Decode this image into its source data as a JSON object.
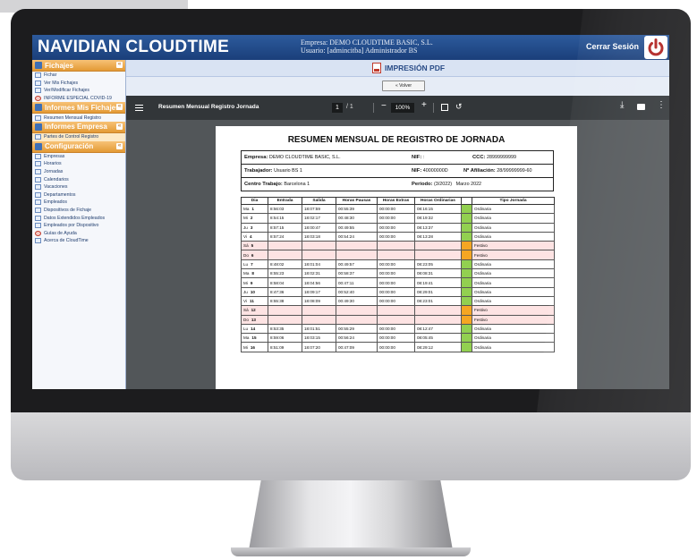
{
  "app": {
    "brand": "NAVIDIAN CLOUDTIME",
    "company_line": "Empresa: DEMO CLOUDTIME BASIC, S.L.",
    "user_line": "Usuario:  [admincitba]  Administrador BS",
    "logout_label": "Cerrar Sesión"
  },
  "sidebar": {
    "sections": [
      {
        "title": "Fichajes",
        "items": [
          {
            "label": "Fichar"
          },
          {
            "label": "Ver Mis Fichajes"
          },
          {
            "label": "Ver/Modificar Fichajes"
          },
          {
            "label": "INFORME ESPECIAL COVID-19"
          }
        ]
      },
      {
        "title": "Informes Mis Fichajes",
        "items": [
          {
            "label": "Resumen Mensual Registro"
          }
        ]
      },
      {
        "title": "Informes Empresa",
        "items": [
          {
            "label": "Partes de Control Registro"
          }
        ]
      },
      {
        "title": "Configuración",
        "items": [
          {
            "label": "Empresas"
          },
          {
            "label": "Horarios"
          },
          {
            "label": "Jornadas"
          },
          {
            "label": "Calendarios"
          },
          {
            "label": "Vacaciones"
          },
          {
            "label": "Departamentos"
          },
          {
            "label": "Empleados"
          },
          {
            "label": "Dispositivos de Fichaje"
          },
          {
            "label": "Datos Extendidos Empleados"
          },
          {
            "label": "Empleados por Dispositivo"
          },
          {
            "label": "Guías de Ayuda"
          },
          {
            "label": "Acerca de CloudTime"
          }
        ]
      }
    ]
  },
  "content": {
    "title": "IMPRESIÓN PDF",
    "back_label": "« Volver"
  },
  "viewer": {
    "doc_title": "Resumen Mensual Registro Jornada",
    "page_current": "1",
    "page_total": "/ 1",
    "zoom": "100%"
  },
  "report": {
    "title": "RESUMEN MENSUAL DE REGISTRO DE JORNADA",
    "empresa_label": "Empresa:",
    "empresa": "DEMO CLOUDTIME BASIC, S.L.",
    "nif_label": "NIF:",
    "nif": ":",
    "ccc_label": "CCC:",
    "ccc": "28999999999",
    "trabajador_label": "Trabajador:",
    "trabajador": "Usuario BS 1",
    "nif2_label": "NIF:",
    "nif2": "40000000D",
    "afiliacion_label": "Nº Afiliación:",
    "afiliacion": "28/99999999-60",
    "centro_label": "Centro Trabajo:",
    "centro": "Barcelona 1",
    "periodo_label": "Periodo:",
    "periodo": "(3/2022)",
    "periodo_text": "Marzo  2022",
    "columns": [
      "Dia",
      "Entrada",
      "Salida",
      "Horas Pausas",
      "Horas Extras",
      "Horas Ordinarias",
      "",
      "Tipo Jornada"
    ],
    "rows": [
      {
        "d": "Ma",
        "n": "1",
        "e": "8:56:03",
        "s": "18:07:59",
        "p": "00:55:39",
        "x": "00:00:00",
        "o": "08:16:15",
        "t": "Ordinaria",
        "h": false
      },
      {
        "d": "Mi",
        "n": "2",
        "e": "8:54:15",
        "s": "18:02:17",
        "p": "00:48:30",
        "x": "00:00:00",
        "o": "08:19:32",
        "t": "Ordinaria",
        "h": false
      },
      {
        "d": "Ju",
        "n": "3",
        "e": "8:57:15",
        "s": "18:00:47",
        "p": "00:49:55",
        "x": "00:00:00",
        "o": "08:13:37",
        "t": "Ordinaria",
        "h": false
      },
      {
        "d": "Vi",
        "n": "4",
        "e": "8:57:24",
        "s": "18:03:18",
        "p": "00:54:24",
        "x": "00:00:00",
        "o": "08:13:28",
        "t": "Ordinaria",
        "h": false
      },
      {
        "d": "Sá",
        "n": "5",
        "e": "",
        "s": "",
        "p": "",
        "x": "",
        "o": "",
        "t": "Festivo",
        "h": true
      },
      {
        "d": "Do",
        "n": "6",
        "e": "",
        "s": "",
        "p": "",
        "x": "",
        "o": "",
        "t": "Festivo",
        "h": true
      },
      {
        "d": "Lu",
        "n": "7",
        "e": "8:48:02",
        "s": "18:01:04",
        "p": "00:49:57",
        "x": "00:00:00",
        "o": "08:23:05",
        "t": "Ordinaria",
        "h": false
      },
      {
        "d": "Ma",
        "n": "8",
        "e": "8:55:23",
        "s": "18:02:31",
        "p": "00:58:37",
        "x": "00:00:00",
        "o": "08:08:31",
        "t": "Ordinaria",
        "h": false
      },
      {
        "d": "Mi",
        "n": "9",
        "e": "8:58:04",
        "s": "18:04:56",
        "p": "00:47:11",
        "x": "00:00:00",
        "o": "08:19:41",
        "t": "Ordinaria",
        "h": false
      },
      {
        "d": "Ju",
        "n": "10",
        "e": "8:47:36",
        "s": "18:09:17",
        "p": "00:52:40",
        "x": "00:00:00",
        "o": "08:29:01",
        "t": "Ordinaria",
        "h": false
      },
      {
        "d": "Vi",
        "n": "11",
        "e": "8:55:38",
        "s": "18:08:09",
        "p": "00:49:30",
        "x": "00:00:00",
        "o": "08:23:01",
        "t": "Ordinaria",
        "h": false
      },
      {
        "d": "Sá",
        "n": "12",
        "e": "",
        "s": "",
        "p": "",
        "x": "",
        "o": "",
        "t": "Festivo",
        "h": true
      },
      {
        "d": "Do",
        "n": "13",
        "e": "",
        "s": "",
        "p": "",
        "x": "",
        "o": "",
        "t": "Festivo",
        "h": true
      },
      {
        "d": "Lu",
        "n": "14",
        "e": "8:53:35",
        "s": "18:01:51",
        "p": "00:55:29",
        "x": "00:00:00",
        "o": "08:12:47",
        "t": "Ordinaria",
        "h": false
      },
      {
        "d": "Ma",
        "n": "15",
        "e": "8:59:06",
        "s": "18:03:15",
        "p": "00:56:24",
        "x": "00:00:00",
        "o": "08:05:45",
        "t": "Ordinaria",
        "h": false
      },
      {
        "d": "Mi",
        "n": "16",
        "e": "8:51:09",
        "s": "18:07:20",
        "p": "00:47:09",
        "x": "00:00:00",
        "o": "08:29:12",
        "t": "Ordinaria",
        "h": false
      }
    ]
  },
  "colors": {
    "brand_blue": "#1a3f7a",
    "section_orange": "#e39a35",
    "ordinaria_green": "#92d050",
    "festivo_orange": "#f5a623",
    "holiday_row": "#fde3e3"
  }
}
